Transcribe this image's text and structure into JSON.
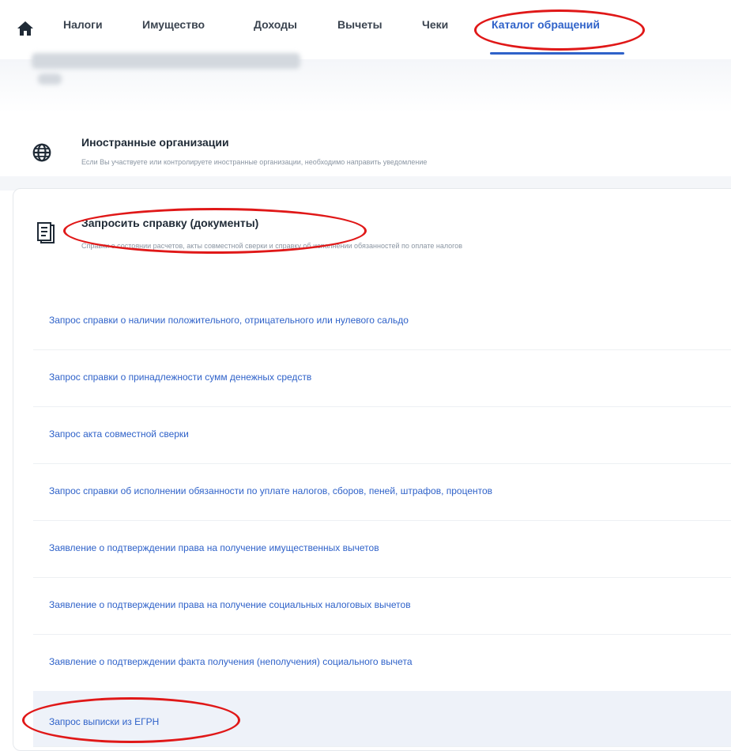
{
  "nav": {
    "items": [
      {
        "label": "Налоги"
      },
      {
        "label": "Имущество"
      },
      {
        "label": "Доходы"
      },
      {
        "label": "Вычеты"
      },
      {
        "label": "Чеки"
      },
      {
        "label": "Каталог обращений",
        "active": true
      }
    ]
  },
  "foreign": {
    "title": "Иностранные организации",
    "desc": "Если Вы участвуете или контролируете иностранные организации, необходимо направить уведомление"
  },
  "certificates": {
    "title": "Запросить справку (документы)",
    "desc": "Справки о состоянии расчетов, акты совместной сверки и справку об исполнении обязанностей по оплате налогов"
  },
  "requests": [
    {
      "label": "Запрос справки о наличии положительного, отрицательного или нулевого сальдо"
    },
    {
      "label": "Запрос справки о принадлежности сумм денежных средств"
    },
    {
      "label": "Запрос акта совместной сверки"
    },
    {
      "label": "Запрос справки об исполнении обязанности по уплате налогов, сборов, пеней, штрафов, процентов"
    },
    {
      "label": "Заявление о подтверждении права на получение имущественных вычетов"
    },
    {
      "label": "Заявление о подтверждении права на получение социальных налоговых вычетов"
    },
    {
      "label": "Заявление о подтверждении факта получения (неполучения) социального вычета"
    },
    {
      "label": "Запрос выписки из ЕГРН"
    }
  ],
  "colors": {
    "accent": "#2f62c9",
    "annotation": "#e01818"
  }
}
